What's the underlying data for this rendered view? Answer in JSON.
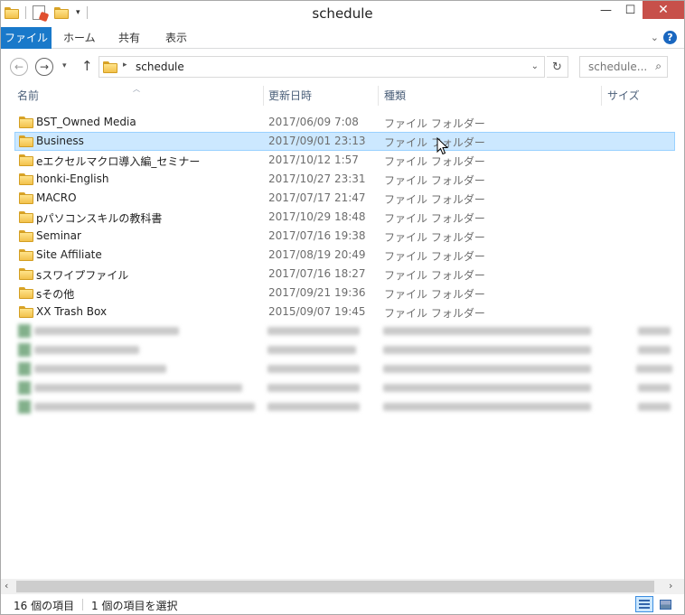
{
  "window": {
    "title": "schedule",
    "qat_dropdown": "▾",
    "minimize": "—",
    "maximize": "☐",
    "close": "✕"
  },
  "ribbon": {
    "tabs": [
      "ファイル",
      "ホーム",
      "共有",
      "表示"
    ],
    "collapse_icon": "⌄",
    "help_icon": "?"
  },
  "nav": {
    "back": "←",
    "forward": "→",
    "dropdown": "▾",
    "up": "↑",
    "breadcrumb_sep": "▸",
    "path": "schedule",
    "address_dropdown": "⌄",
    "refresh": "↻",
    "search_placeholder": "schedule...",
    "search_icon": "⌕"
  },
  "columns": {
    "name": "名前",
    "date": "更新日時",
    "type": "種類",
    "size": "サイズ",
    "sort_indicator": "︿"
  },
  "folders": [
    {
      "name": "BST_Owned Media",
      "date": "2017/06/09 7:08",
      "type": "ファイル フォルダー"
    },
    {
      "name": "Business",
      "date": "2017/09/01 23:13",
      "type": "ファイル フォルダー",
      "selected": true
    },
    {
      "name": "eエクセルマクロ導入編_セミナー",
      "date": "2017/10/12 1:57",
      "type": "ファイル フォルダー"
    },
    {
      "name": "honki-English",
      "date": "2017/10/27 23:31",
      "type": "ファイル フォルダー"
    },
    {
      "name": "MACRO",
      "date": "2017/07/17 21:47",
      "type": "ファイル フォルダー"
    },
    {
      "name": "pパソコンスキルの教科書",
      "date": "2017/10/29 18:48",
      "type": "ファイル フォルダー"
    },
    {
      "name": "Seminar",
      "date": "2017/07/16 19:38",
      "type": "ファイル フォルダー"
    },
    {
      "name": "Site Affiliate",
      "date": "2017/08/19 20:49",
      "type": "ファイル フォルダー"
    },
    {
      "name": "sスワイプファイル",
      "date": "2017/07/16 18:27",
      "type": "ファイル フォルダー"
    },
    {
      "name": "sその他",
      "date": "2017/09/21 19:36",
      "type": "ファイル フォルダー"
    },
    {
      "name": "XX Trash Box",
      "date": "2015/09/07 19:45",
      "type": "ファイル フォルダー"
    }
  ],
  "scrollbar": {
    "left": "‹",
    "right": "›"
  },
  "status": {
    "count": "16 個の項目",
    "selected": "1 個の項目を選択"
  },
  "colors": {
    "file_tab": "#1979ca",
    "selection": "#cce8ff",
    "close_button": "#c7504a"
  }
}
